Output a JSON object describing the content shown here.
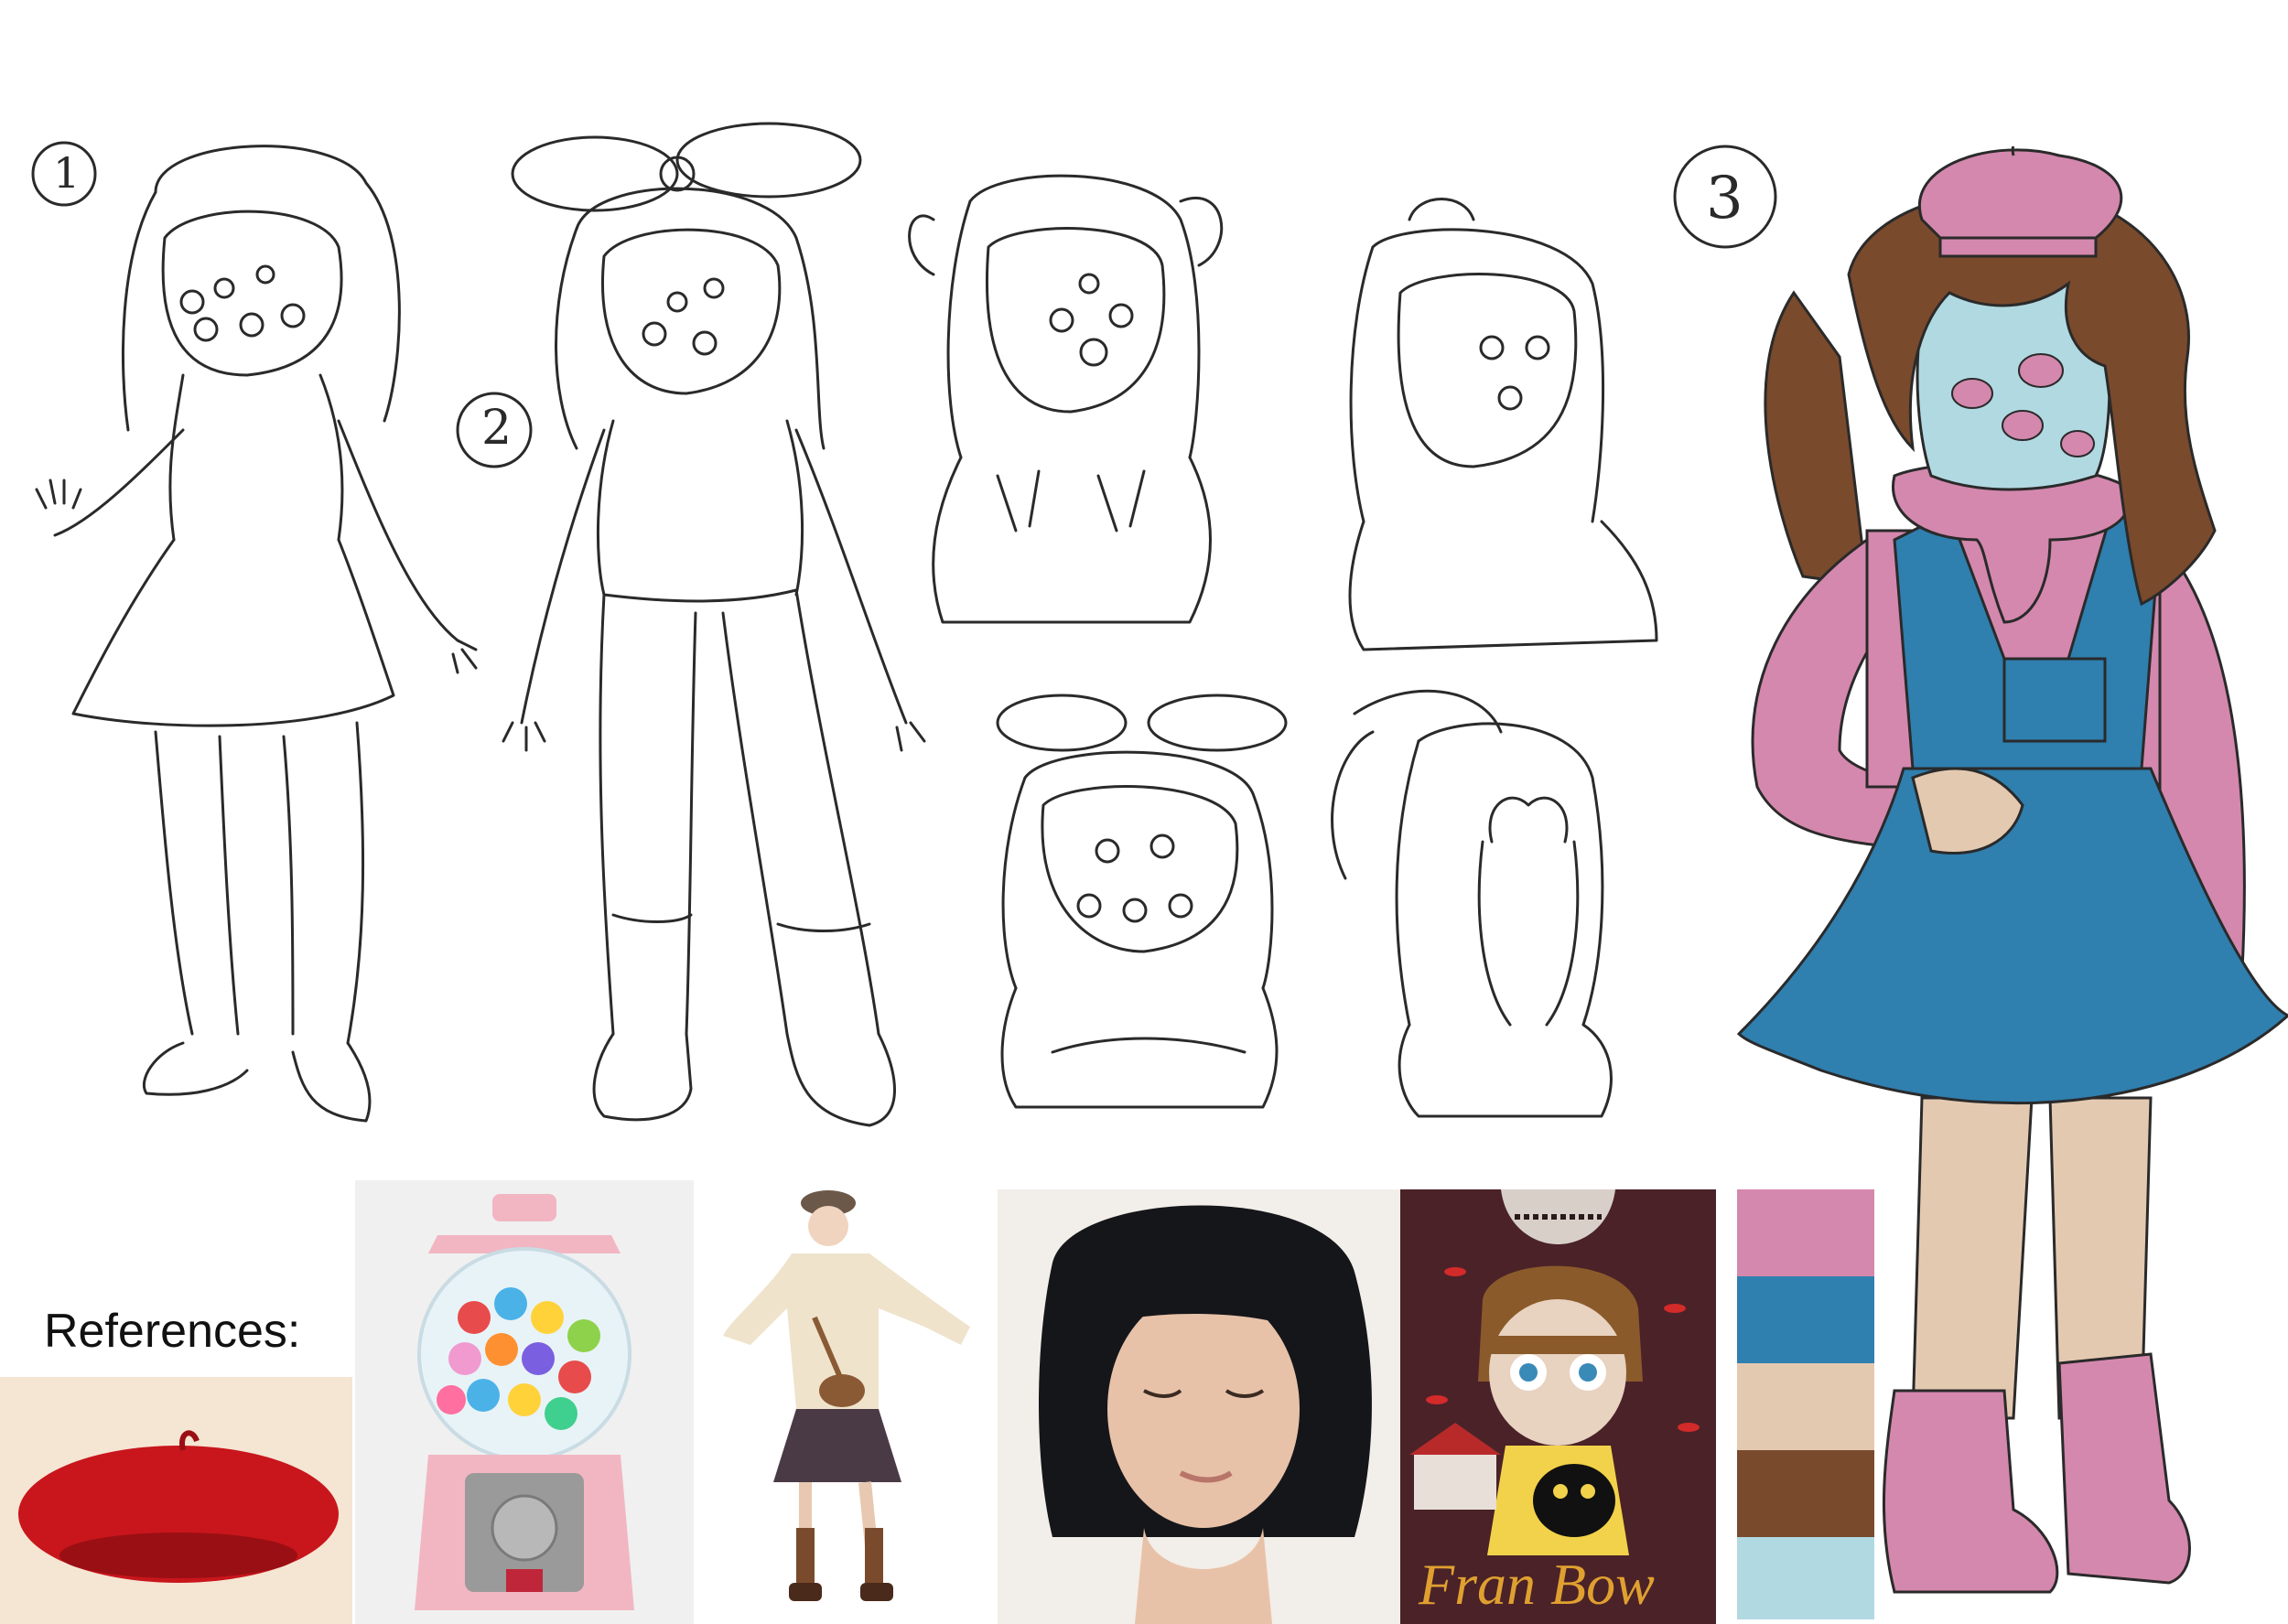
{
  "sketch_labels": {
    "one": "1",
    "two": "2",
    "three": "3"
  },
  "references": {
    "label": "References:",
    "poster_title": "Fran Bow"
  },
  "palette": {
    "colors": [
      "#d488ad",
      "#2f7faf",
      "#e4c9b1",
      "#7a4a2c",
      "#b1d9e2"
    ]
  },
  "character": {
    "hat_color": "#d488ad",
    "hair_color": "#7a4a2c",
    "face_color": "#b1d9e2",
    "spots_color": "#d488ad",
    "sweater_color": "#d488ad",
    "overalls_color": "#2f7faf",
    "skin_color": "#e4c9b1",
    "boots_color": "#d488ad"
  }
}
